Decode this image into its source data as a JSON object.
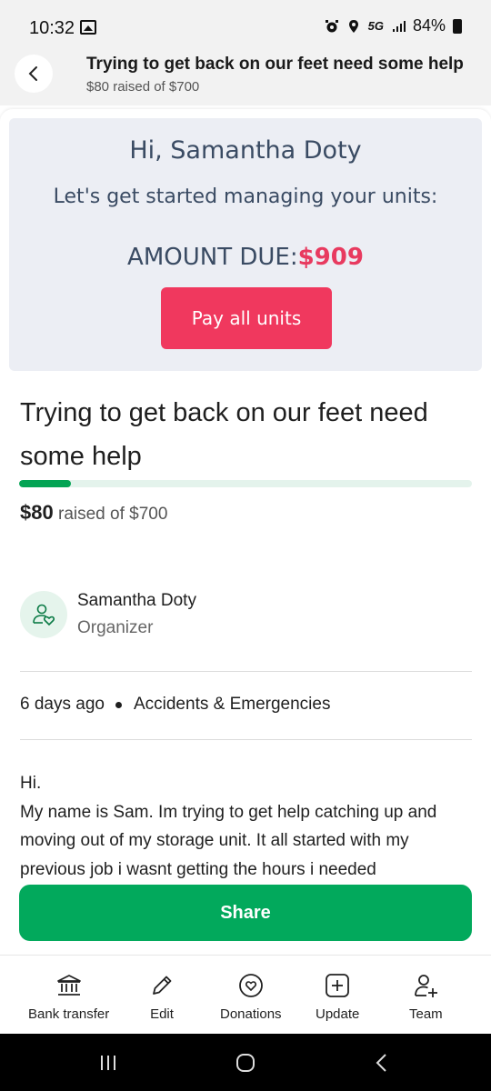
{
  "status_bar": {
    "time": "10:32",
    "network": "5G",
    "battery": "84%"
  },
  "header": {
    "title": "Trying to get back on our feet need some help",
    "subtitle": "$80 raised of $700"
  },
  "manage_card": {
    "greeting": "Hi, Samantha Doty",
    "subtitle": "Let's get started managing your units:",
    "amount_label": "AMOUNT DUE:",
    "amount_value": "$909",
    "pay_button": "Pay all units"
  },
  "fundraiser": {
    "title": "Trying to get back on our feet need some help",
    "raised_amount": "$80",
    "raised_suffix": "raised of $700",
    "progress_fraction": 0.114
  },
  "organizer": {
    "name": "Samantha Doty",
    "role": "Organizer"
  },
  "meta": {
    "posted": "6 days ago",
    "category": "Accidents & Emergencies"
  },
  "story": {
    "lines": [
      "Hi.",
      "My name is Sam. Im trying to get help catching up and moving out of my storage unit. It all started with my previous job i wasnt getting the hours i needed"
    ]
  },
  "share_button": "Share",
  "bottom_nav": [
    {
      "label": "Bank transfer",
      "icon": "bank-icon"
    },
    {
      "label": "Edit",
      "icon": "pencil-icon"
    },
    {
      "label": "Donations",
      "icon": "heart-circle-icon"
    },
    {
      "label": "Update",
      "icon": "plus-square-icon"
    },
    {
      "label": "Team",
      "icon": "add-person-icon"
    }
  ],
  "colors": {
    "accent_green": "#02a95c",
    "pay_red": "#f0385e",
    "amount_red": "#e83a5f"
  }
}
